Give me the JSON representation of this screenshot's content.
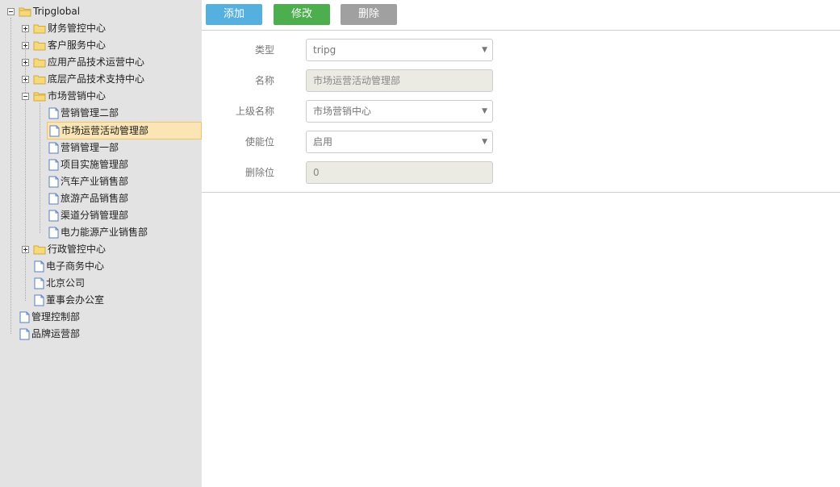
{
  "tree": {
    "root": "Tripglobal",
    "level1": [
      {
        "label": "财务管控中心"
      },
      {
        "label": "客户服务中心"
      },
      {
        "label": "应用产品技术运营中心"
      },
      {
        "label": "底层产品技术支持中心"
      },
      {
        "label": "市场营销中心"
      }
    ],
    "market_children": [
      {
        "label": "营销管理二部"
      },
      {
        "label": "市场运营活动管理部"
      },
      {
        "label": "营销管理一部"
      },
      {
        "label": "项目实施管理部"
      },
      {
        "label": "汽车产业销售部"
      },
      {
        "label": "旅游产品销售部"
      },
      {
        "label": "渠道分销管理部"
      },
      {
        "label": "电力能源产业销售部"
      }
    ],
    "level1_after": [
      {
        "label": "行政管控中心"
      },
      {
        "label": "电子商务中心"
      },
      {
        "label": "北京公司"
      },
      {
        "label": "董事会办公室"
      }
    ],
    "root_leaves": [
      {
        "label": "管理控制部"
      },
      {
        "label": "品牌运营部"
      }
    ]
  },
  "toolbar": {
    "add": "添加",
    "edit": "修改",
    "delete": "删除"
  },
  "form": {
    "type_label": "类型",
    "type_value": "tripg",
    "name_label": "名称",
    "name_value": "市场运营活动管理部",
    "parent_label": "上级名称",
    "parent_value": "市场营销中心",
    "enabled_label": "使能位",
    "enabled_value": "启用",
    "deleted_label": "删除位",
    "deleted_value": "0"
  },
  "colors": {
    "add": "#55b0e0",
    "edit": "#4cae4c",
    "delete": "#a0a0a0",
    "selected_bg": "#fbe5b4"
  }
}
